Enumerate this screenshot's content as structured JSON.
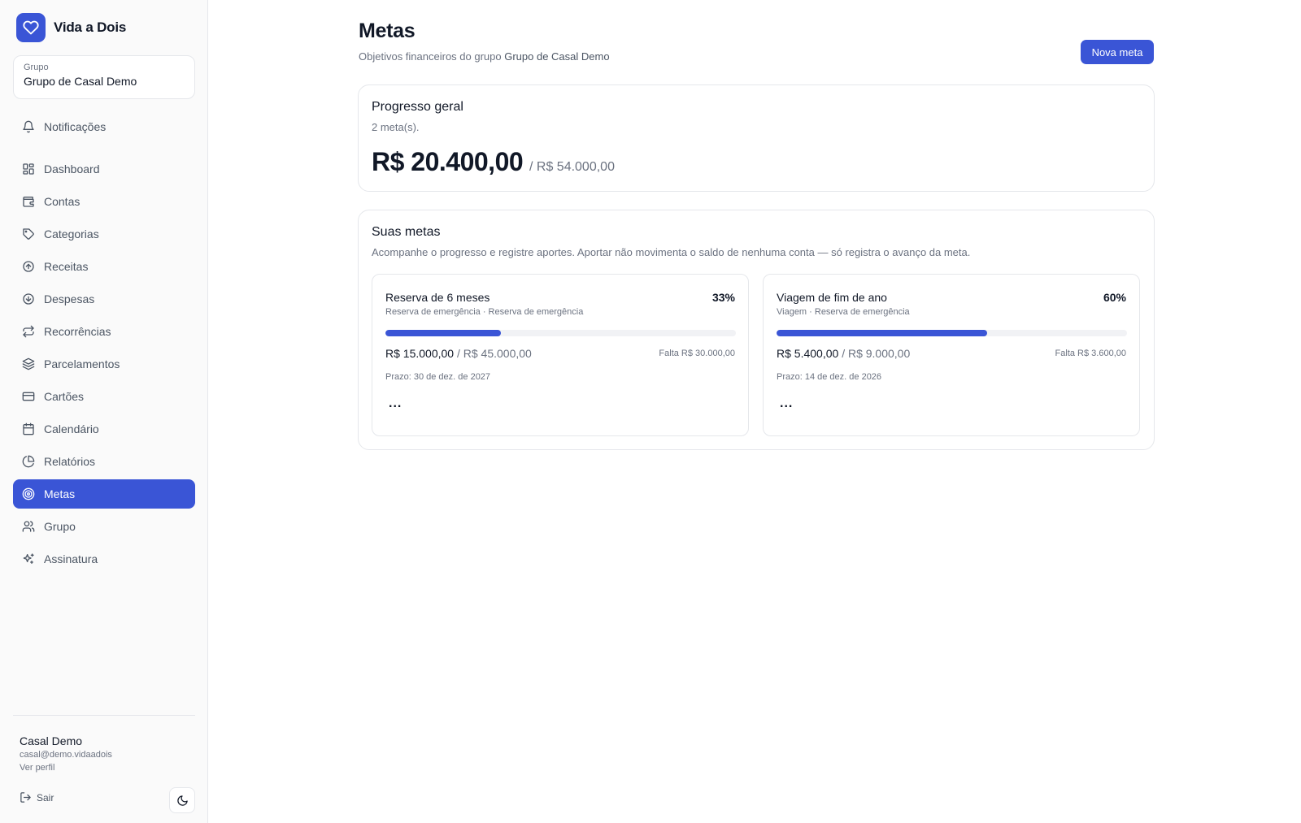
{
  "brand": {
    "name": "Vida a Dois",
    "logo_icon": "heart-icon"
  },
  "group_selector": {
    "label": "Grupo",
    "value": "Grupo de Casal Demo"
  },
  "notifications": {
    "label": "Notificações",
    "icon": "bell-icon"
  },
  "nav": [
    {
      "label": "Dashboard",
      "icon": "dashboard-icon",
      "active": false
    },
    {
      "label": "Contas",
      "icon": "wallet-icon",
      "active": false
    },
    {
      "label": "Categorias",
      "icon": "tag-icon",
      "active": false
    },
    {
      "label": "Receitas",
      "icon": "arrow-up-circle-icon",
      "active": false
    },
    {
      "label": "Despesas",
      "icon": "arrow-down-circle-icon",
      "active": false
    },
    {
      "label": "Recorrências",
      "icon": "repeat-icon",
      "active": false
    },
    {
      "label": "Parcelamentos",
      "icon": "layers-icon",
      "active": false
    },
    {
      "label": "Cartões",
      "icon": "credit-card-icon",
      "active": false
    },
    {
      "label": "Calendário",
      "icon": "calendar-icon",
      "active": false
    },
    {
      "label": "Relatórios",
      "icon": "pie-chart-icon",
      "active": false
    },
    {
      "label": "Metas",
      "icon": "target-icon",
      "active": true
    },
    {
      "label": "Grupo",
      "icon": "users-icon",
      "active": false
    },
    {
      "label": "Assinatura",
      "icon": "sparkles-icon",
      "active": false
    }
  ],
  "user": {
    "name": "Casal Demo",
    "email": "casal@demo.vidaadois",
    "profile_link": "Ver perfil"
  },
  "logout_label": "Sair",
  "theme_toggle_icon": "moon-icon",
  "page": {
    "title": "Metas",
    "subtitle_prefix": "Objetivos financeiros do grupo",
    "subtitle_group": "Grupo de Casal Demo",
    "new_button": "Nova meta"
  },
  "overall": {
    "title": "Progresso geral",
    "count": "2 meta(s).",
    "saved": "R$ 20.400,00",
    "total": "/ R$ 54.000,00"
  },
  "goals_section": {
    "title": "Suas metas",
    "description": "Acompanhe o progresso e registre aportes. Aportar não movimenta o saldo de nenhuma conta — só registra o avanço da meta."
  },
  "goals": [
    {
      "name": "Reserva de 6 meses",
      "percent_label": "33%",
      "progress": 0.33,
      "categories": "Reserva de emergência · Reserva de emergência",
      "saved": "R$ 15.000,00",
      "target": "/ R$ 45.000,00",
      "missing": "Falta R$ 30.000,00",
      "deadline": "Prazo: 30 de dez. de 2027",
      "menu": "..."
    },
    {
      "name": "Viagem de fim de ano",
      "percent_label": "60%",
      "progress": 0.6,
      "categories": "Viagem · Reserva de emergência",
      "saved": "R$ 5.400,00",
      "target": "/ R$ 9.000,00",
      "missing": "Falta R$ 3.600,00",
      "deadline": "Prazo: 14 de dez. de 2026",
      "menu": "..."
    }
  ],
  "colors": {
    "accent": "#3a55d6",
    "border": "#e5e7eb",
    "muted_text": "#6b7280"
  }
}
